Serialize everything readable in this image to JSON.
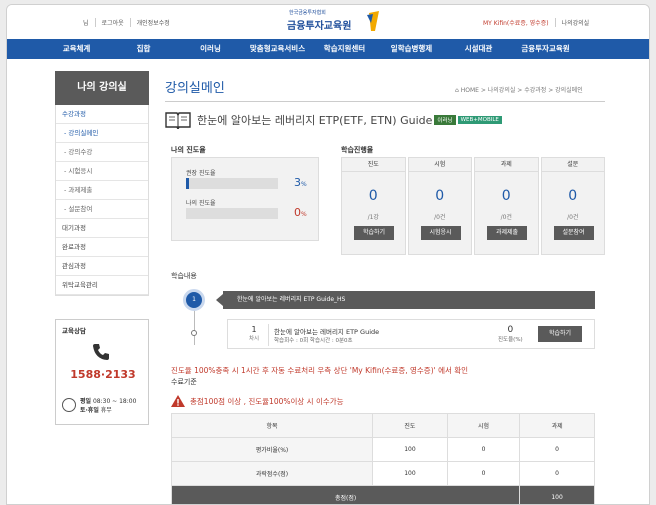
{
  "top_links_left": [
    "님",
    "로그아웃",
    "개인정보수정"
  ],
  "logo": {
    "small": "한국금융투자협회",
    "big": "금융투자교육원"
  },
  "top_links_right": [
    "MY Kifin(수료증, 영수증)",
    "나의강의실"
  ],
  "gnb": [
    "교육체계",
    "집합",
    "이러닝",
    "맞춤형교육서비스",
    "학습지원센터",
    "일학습병행제",
    "시설대관",
    "금융투자교육원"
  ],
  "lnb": {
    "title": "나의 강의실",
    "items": [
      {
        "label": "수강과정",
        "kind": "group"
      },
      {
        "label": "- 강의실메인",
        "kind": "active"
      },
      {
        "label": "- 강의수강",
        "kind": "sub"
      },
      {
        "label": "- 시험응시",
        "kind": "sub"
      },
      {
        "label": "- 과제제출",
        "kind": "sub"
      },
      {
        "label": "- 설문참여",
        "kind": "sub"
      },
      {
        "label": "대기과정",
        "kind": "item"
      },
      {
        "label": "완료과정",
        "kind": "item"
      },
      {
        "label": "관심과정",
        "kind": "item"
      },
      {
        "label": "위탁교육관리",
        "kind": "item"
      }
    ]
  },
  "counsel": {
    "title": "교육상담",
    "phone": "1588·2133",
    "weekday_label": "평일",
    "weekday_hours": "08:30 ~ 18:00",
    "holiday_label": "토·휴일",
    "holiday_value": "휴무"
  },
  "main": {
    "page_title": "강의실메인",
    "breadcrumb": "⌂ HOME > 나의강의실 > 수강과정 > 강의실메인",
    "course_title": "한눈에 알아보는 레버리지 ETP(ETF, ETN) Guide",
    "badges": [
      "이러닝",
      "WEB+MOBILE"
    ]
  },
  "progress": {
    "label": "나의 진도율",
    "recommended_label": "권장 진도율",
    "recommended_value": 3,
    "mine_label": "나의 진도율",
    "mine_value": 0,
    "unit": "%"
  },
  "status": {
    "label": "학습진행율",
    "cards": [
      {
        "head": "진도",
        "num": "0",
        "sub": "/1강",
        "btn": "학습하기"
      },
      {
        "head": "시험",
        "num": "0",
        "sub": "/0건",
        "btn": "시험응시"
      },
      {
        "head": "과제",
        "num": "0",
        "sub": "/0건",
        "btn": "과제제출"
      },
      {
        "head": "설문",
        "num": "0",
        "sub": "/0건",
        "btn": "설문참여"
      }
    ]
  },
  "content": {
    "label": "학습내용",
    "chapter_num": "1",
    "chapter_title": "한눈에 알아보는 레버리지 ETP Guide_HS",
    "lesson_num": "1",
    "lesson_unit": "차시",
    "lesson_title": "한눈에 알아보는 레버리지 ETP Guide",
    "lesson_meta": "학습회수 : 0회  학습시간 : 0분0초",
    "lesson_progress": "0",
    "lesson_progress_label": "진도율(%)",
    "lesson_btn": "학습하기"
  },
  "notice": {
    "red": "진도율 100%충족 시 1시간 후 자동 수료처리 우측 상단 'My Kifin(수료증, 영수증)' 에서 확인",
    "sub": "수료기준",
    "warn": "총점100점 이상 , 진도율100%이상 시 이수가능"
  },
  "grade_table": {
    "headers": [
      "항목",
      "진도",
      "시험",
      "과제"
    ],
    "rows": [
      [
        "평가비율(%)",
        "100",
        "0",
        "0"
      ],
      [
        "과락점수(점)",
        "100",
        "0",
        "0"
      ]
    ],
    "total_label": "총점(점)",
    "total_value": "100"
  }
}
